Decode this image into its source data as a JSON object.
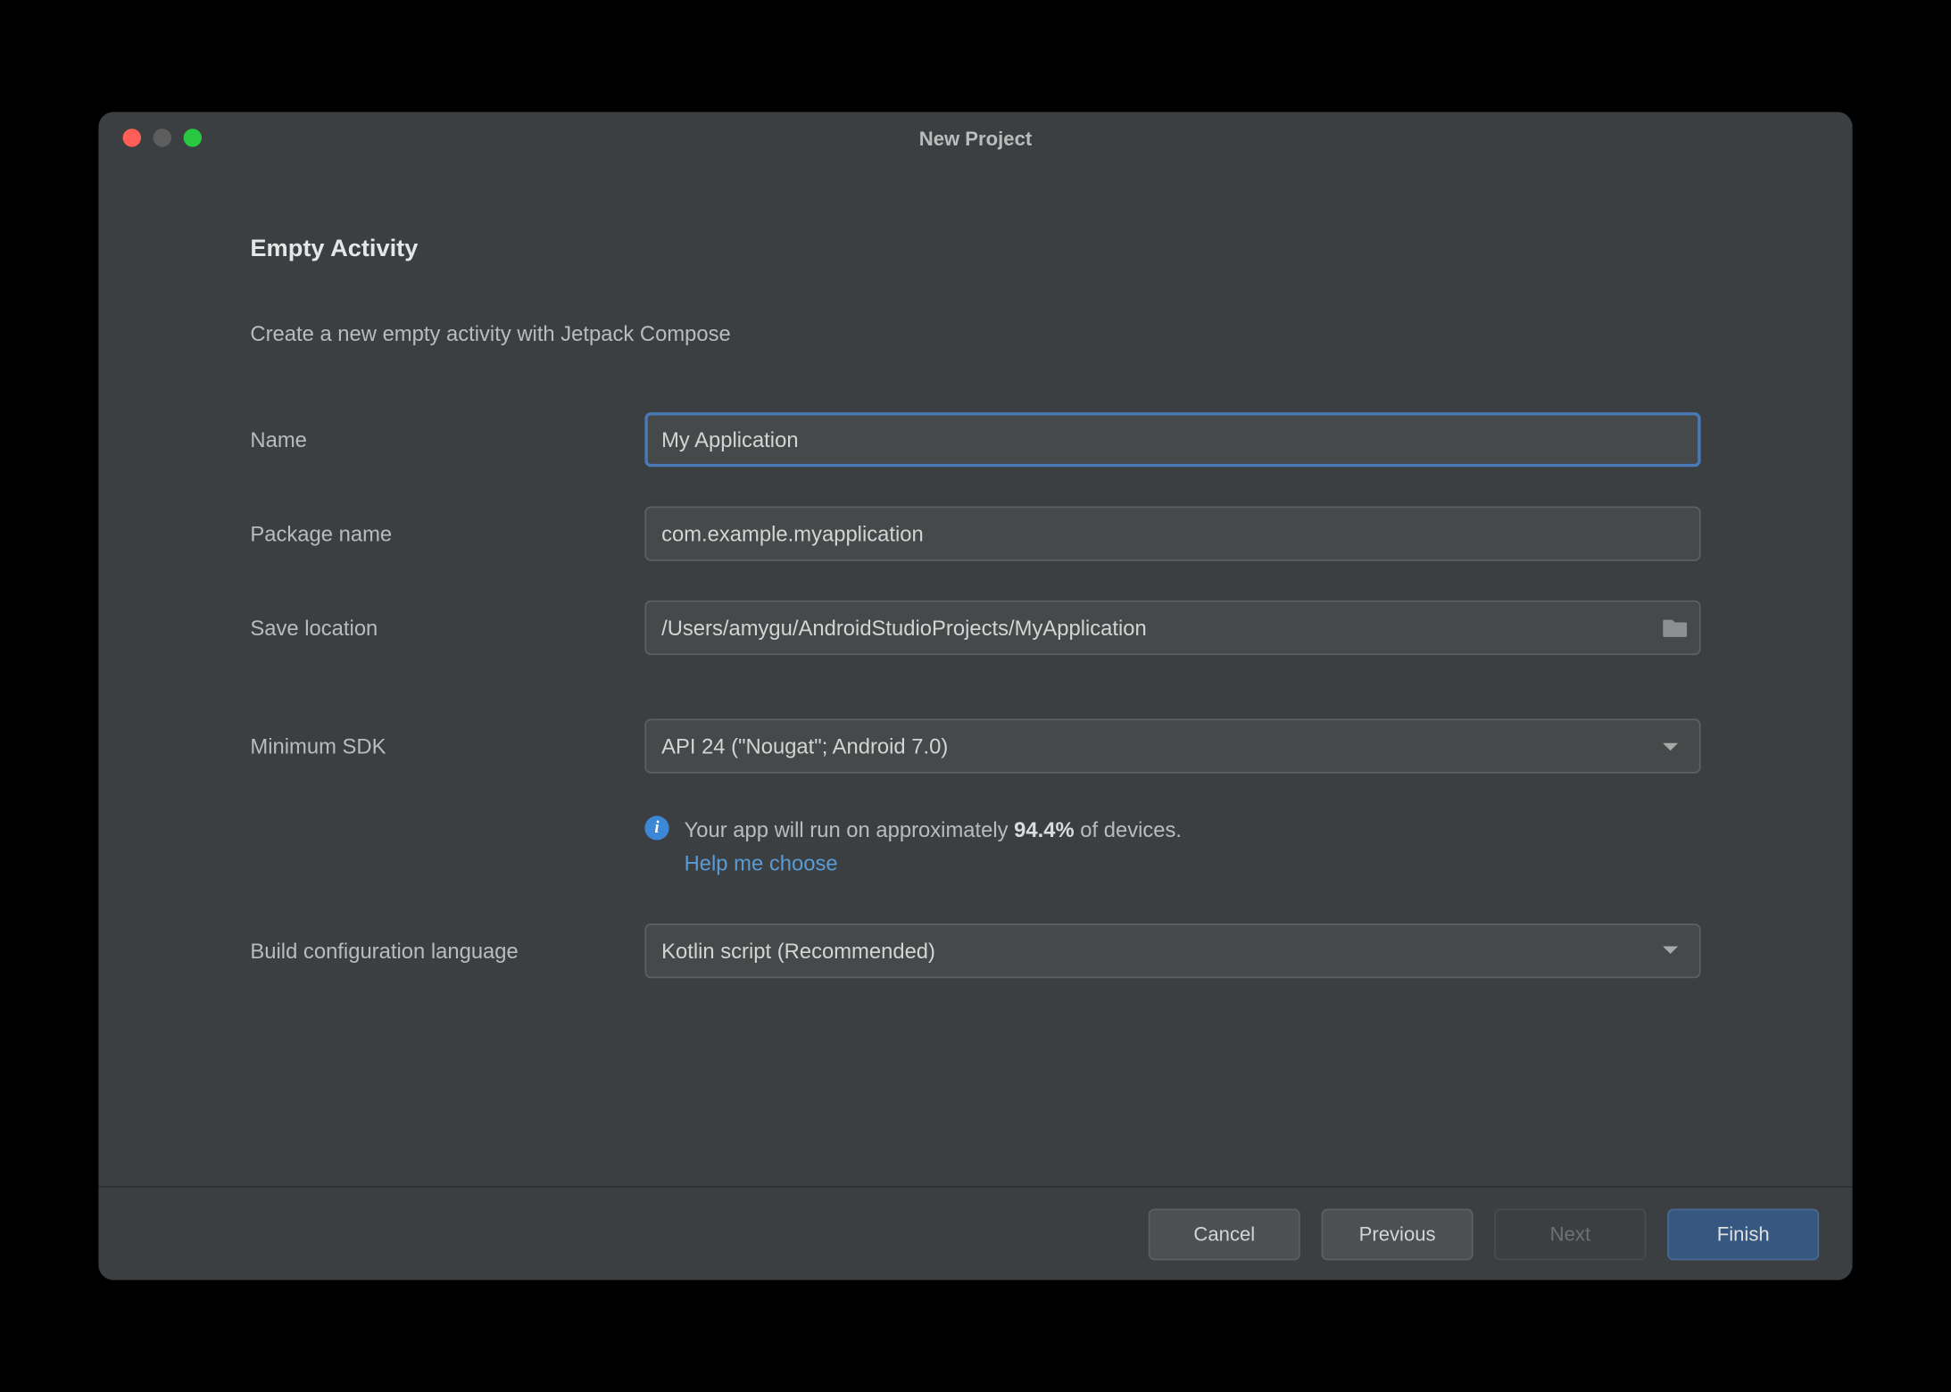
{
  "window": {
    "title": "New Project"
  },
  "page": {
    "heading": "Empty Activity",
    "description": "Create a new empty activity with Jetpack Compose"
  },
  "form": {
    "name": {
      "label": "Name",
      "value": "My Application"
    },
    "package": {
      "label": "Package name",
      "value": "com.example.myapplication"
    },
    "save_location": {
      "label": "Save location",
      "value": "/Users/amygu/AndroidStudioProjects/MyApplication"
    },
    "min_sdk": {
      "label": "Minimum SDK",
      "value": "API 24 (\"Nougat\"; Android 7.0)"
    },
    "build_lang": {
      "label": "Build configuration language",
      "value": "Kotlin script (Recommended)"
    }
  },
  "info": {
    "text_prefix": "Your app will run on approximately ",
    "percent": "94.4%",
    "text_suffix": " of devices.",
    "help_link": "Help me choose"
  },
  "footer": {
    "cancel": "Cancel",
    "previous": "Previous",
    "next": "Next",
    "finish": "Finish"
  }
}
